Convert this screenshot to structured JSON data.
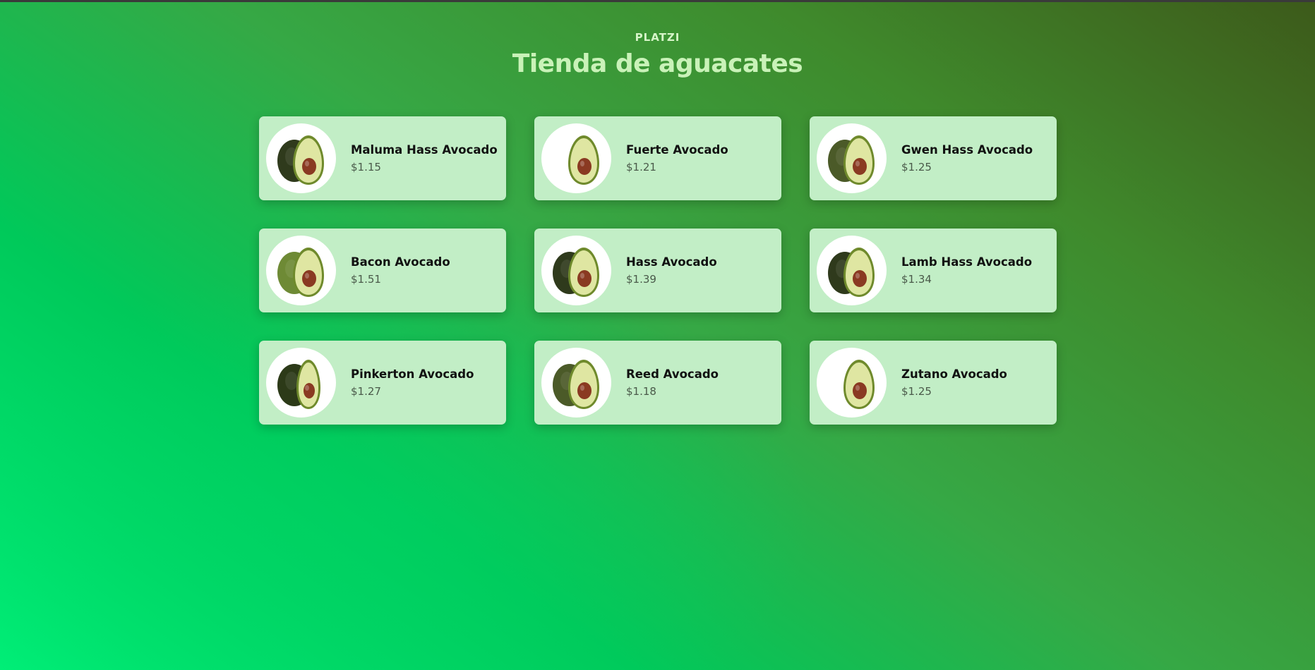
{
  "header": {
    "brand": "PLATZI",
    "title": "Tienda de aguacates"
  },
  "products": [
    {
      "name": "Maluma Hass Avocado",
      "price": "$1.15",
      "image": "avocado-half-dark-skin"
    },
    {
      "name": "Fuerte Avocado",
      "price": "$1.21",
      "image": "avocado-half-pear"
    },
    {
      "name": "Gwen Hass Avocado",
      "price": "$1.25",
      "image": "avocado-half-round"
    },
    {
      "name": "Bacon Avocado",
      "price": "$1.51",
      "image": "avocado-half-light-skin"
    },
    {
      "name": "Hass Avocado",
      "price": "$1.39",
      "image": "avocado-half-dark-skin"
    },
    {
      "name": "Lamb Hass Avocado",
      "price": "$1.34",
      "image": "avocado-half-dark-skin"
    },
    {
      "name": "Pinkerton Avocado",
      "price": "$1.27",
      "image": "avocado-half-long"
    },
    {
      "name": "Reed Avocado",
      "price": "$1.18",
      "image": "avocado-half-round"
    },
    {
      "name": "Zutano Avocado",
      "price": "$1.25",
      "image": "avocado-half-pear"
    }
  ],
  "colors": {
    "card_background": "#c2eec6",
    "title": "#c9f2b8",
    "avocado_skin_dark": "#2f3a1c",
    "avocado_skin_light": "#6e8a35",
    "avocado_flesh": "#dfe6a2",
    "avocado_seed": "#8a3a22"
  }
}
